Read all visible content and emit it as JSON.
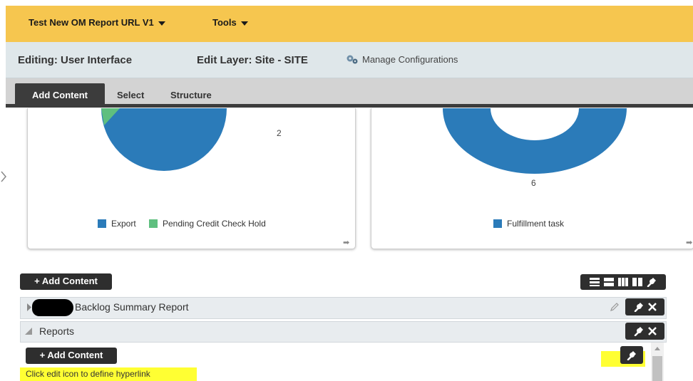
{
  "topbar": {
    "report_menu": "Test New OM Report URL V1",
    "tools_menu": "Tools"
  },
  "editbar": {
    "editing": "Editing: User Interface",
    "edit_layer": "Edit Layer: Site - SITE",
    "manage": "Manage Configurations"
  },
  "tabs": [
    "Add Content",
    "Select",
    "Structure"
  ],
  "charts": [
    {
      "number_label": "2",
      "legend": [
        {
          "label": "Export",
          "color": "#2b7bb9"
        },
        {
          "label": "Pending Credit Check Hold",
          "color": "#5fbf7f"
        }
      ]
    },
    {
      "number_label": "6",
      "legend": [
        {
          "label": "Fulfillment task",
          "color": "#2b7bb9"
        }
      ]
    }
  ],
  "region": {
    "add_content": "+ Add Content",
    "backlog_title": "Backlog Summary Report",
    "reports_title": "Reports",
    "inner_add_content": "+ Add Content",
    "hint": "Click edit icon to define hyperlink"
  },
  "colors": {
    "topbar": "#f6c64f",
    "chart_blue": "#2b7bb9",
    "chart_green": "#5fbf7f",
    "highlight": "#ffff33"
  }
}
